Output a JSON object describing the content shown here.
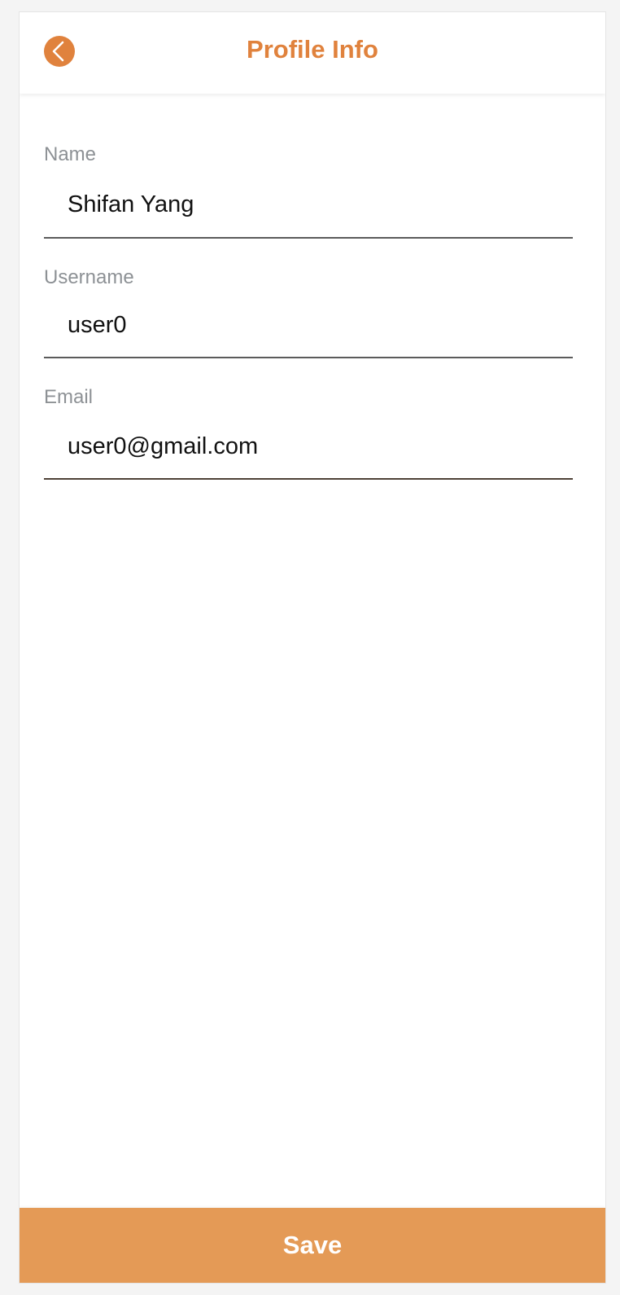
{
  "header": {
    "title": "Profile Info",
    "back_icon": "chevron-left-icon"
  },
  "form": {
    "name": {
      "label": "Name",
      "value": "Shifan Yang"
    },
    "username": {
      "label": "Username",
      "value": "user0"
    },
    "email": {
      "label": "Email",
      "value": "user0@gmail.com"
    }
  },
  "footer": {
    "save_label": "Save"
  },
  "colors": {
    "accent": "#e0823d",
    "save_button": "#e49a56",
    "label_gray": "#8d9195"
  }
}
